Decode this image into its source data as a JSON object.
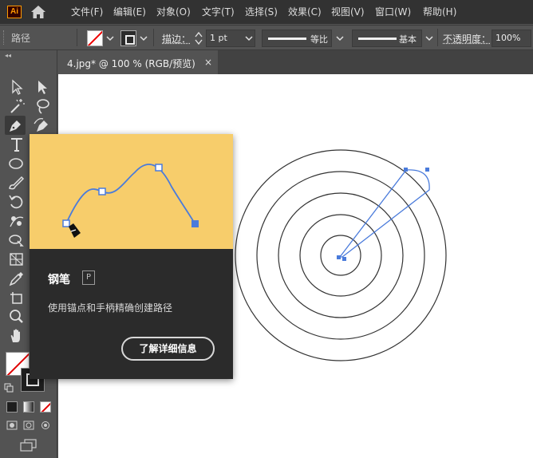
{
  "app": {
    "logo_text": "Ai"
  },
  "menu": [
    {
      "id": "file",
      "label": "文件(F)"
    },
    {
      "id": "edit",
      "label": "编辑(E)"
    },
    {
      "id": "object",
      "label": "对象(O)"
    },
    {
      "id": "type",
      "label": "文字(T)"
    },
    {
      "id": "select",
      "label": "选择(S)"
    },
    {
      "id": "effect",
      "label": "效果(C)"
    },
    {
      "id": "view",
      "label": "视图(V)"
    },
    {
      "id": "window",
      "label": "窗口(W)"
    },
    {
      "id": "help",
      "label": "帮助(H)"
    }
  ],
  "control_bar": {
    "selection_type": "路径",
    "stroke_label": "描边：",
    "stroke_weight": "1 pt",
    "variable_width_profile": "等比",
    "brush_definition": "基本",
    "opacity_label": "不透明度：",
    "opacity_value": "100%"
  },
  "document_tab": {
    "title": "4.jpg* @ 100 % (RGB/预览)",
    "close": "×"
  },
  "tooltip": {
    "title": "钢笔",
    "shortcut": "P",
    "description": "使用锚点和手柄精确创建路径",
    "button": "了解详细信息"
  },
  "colors": {
    "accent_blue": "#4a7bdb",
    "tooltip_yellow": "#f7cd6b",
    "ui_dark": "#323232",
    "ui_panel": "#535353"
  }
}
